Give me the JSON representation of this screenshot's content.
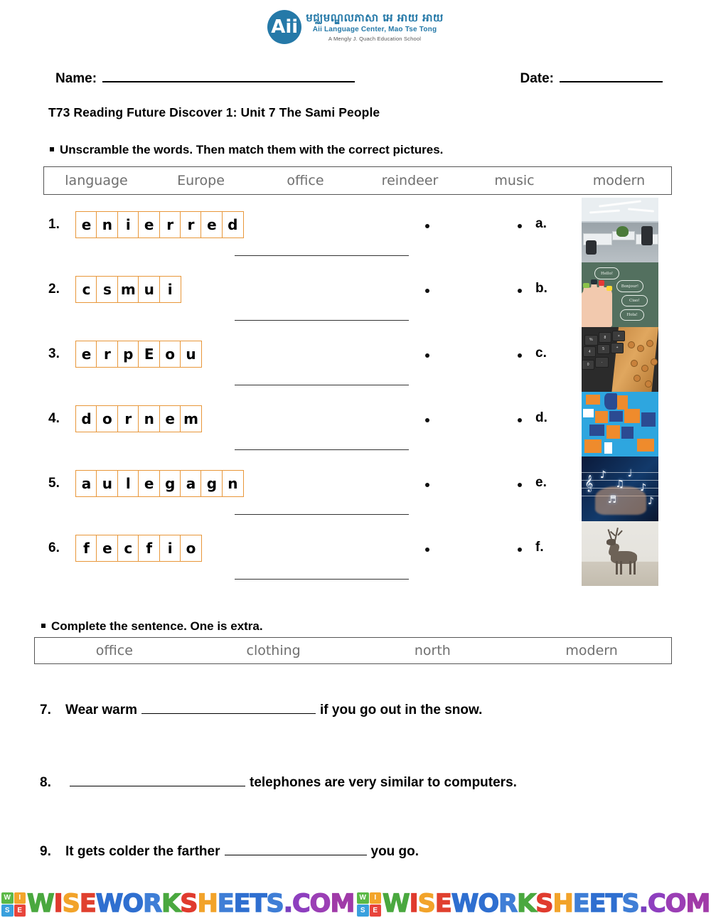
{
  "logo": {
    "badge": "Aii",
    "khmer": "មជ្ឈមណ្ឌលភាសា អេ អាយ អាយ",
    "line2": "Aii Language Center, Mao Tse Tong",
    "line3": "A Mengly J. Quach Education School",
    "color": "#2579a8"
  },
  "header": {
    "name_label": "Name:",
    "date_label": "Date:",
    "title": "T73 Reading Future Discover 1: Unit 7 The Sami People"
  },
  "section1": {
    "instruction": "Unscramble the words. Then match them with the correct pictures.",
    "wordbank": [
      "language",
      "Europe",
      "office",
      "reindeer",
      "music",
      "modern"
    ],
    "items": [
      {
        "num": "1.",
        "letters": [
          "e",
          "n",
          "i",
          "e",
          "r",
          "r",
          "e",
          "d"
        ],
        "answer": "",
        "option": "a."
      },
      {
        "num": "2.",
        "letters": [
          "c",
          "s",
          "m",
          "u",
          "i"
        ],
        "answer": "",
        "option": "b."
      },
      {
        "num": "3.",
        "letters": [
          "e",
          "r",
          "p",
          "E",
          "o",
          "u"
        ],
        "answer": "",
        "option": "c."
      },
      {
        "num": "4.",
        "letters": [
          "d",
          "o",
          "r",
          "n",
          "e",
          "m"
        ],
        "answer": "",
        "option": "d."
      },
      {
        "num": "5.",
        "letters": [
          "a",
          "u",
          "l",
          "e",
          "g",
          "a",
          "g",
          "n"
        ],
        "answer": "",
        "option": "e."
      },
      {
        "num": "6.",
        "letters": [
          "f",
          "e",
          "c",
          "f",
          "i",
          "o"
        ],
        "answer": "",
        "option": "f."
      }
    ],
    "pictures": [
      {
        "option": "a.",
        "name": "office-interior-photo",
        "alt": "modern open-plan office"
      },
      {
        "option": "b.",
        "name": "language-chalkboard-photo",
        "alt": "hand with greeting speech bubbles"
      },
      {
        "option": "c.",
        "name": "calculator-abacus-photo",
        "alt": "calculator keypad and wooden abacus"
      },
      {
        "option": "d.",
        "name": "europe-map-photo",
        "alt": "map of Europe in orange and blue"
      },
      {
        "option": "e.",
        "name": "music-notes-photo",
        "alt": "glowing musical notes on blue"
      },
      {
        "option": "f.",
        "name": "reindeer-photo",
        "alt": "reindeer standing in snow"
      }
    ]
  },
  "section2": {
    "instruction": "Complete the sentence. One is extra.",
    "wordbank": [
      "office",
      "clothing",
      "north",
      "modern"
    ],
    "sentences": [
      {
        "num": "7.",
        "before": "Wear warm",
        "after": "if you go out in the snow.",
        "answer": ""
      },
      {
        "num": "8.",
        "before": "",
        "after": "telephones are very similar to computers.",
        "answer": ""
      },
      {
        "num": "9.",
        "before": "It gets colder the farther",
        "after": "you go.",
        "answer": ""
      }
    ]
  },
  "footer": {
    "tile": [
      "W",
      "I",
      "S",
      "E"
    ],
    "tile_colors": [
      "#5bb947",
      "#f3a52b",
      "#3aa0dd",
      "#e8453c"
    ],
    "wordmark": "WISEWORKSHEETS.COM",
    "letter_colors": [
      "#4aa83f",
      "#e03b2e",
      "#f2a32a",
      "#e0402f",
      "#2f6fd0",
      "#2f6fd0",
      "#3f7ed6",
      "#4aa83f",
      "#e03b2e",
      "#f2a32a",
      "#3f7ed6",
      "#2f6fd0",
      "#2f6fd0",
      "#3f7ed6",
      "#7a3fbf",
      "#8e3fbf",
      "#9b3fb5",
      "#a03aa8"
    ]
  }
}
